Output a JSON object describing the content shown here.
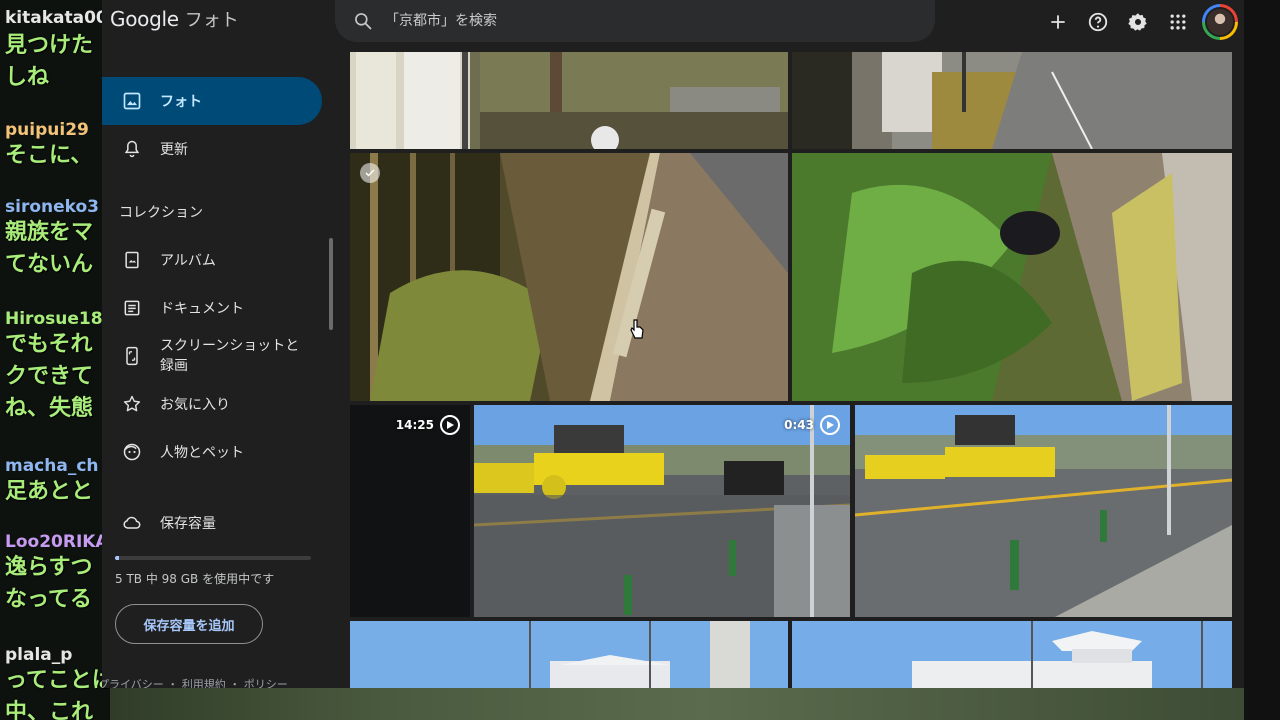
{
  "chat": {
    "messages": [
      {
        "user": "kitakata00",
        "lines": [
          "見つけた",
          "しね"
        ]
      },
      {
        "user": "puipui29",
        "lines": [
          "そこに、"
        ]
      },
      {
        "user": "sironeko3",
        "lines": [
          "親族をマ",
          "てないん"
        ]
      },
      {
        "user": "Hirosue18",
        "lines": [
          "でもそれ",
          "クできて",
          "ね、失態"
        ]
      },
      {
        "user": "macha_ch",
        "lines": [
          "足あとと"
        ]
      },
      {
        "user": "Loo20RIKA",
        "lines": [
          "逸らすつ",
          "なってる"
        ]
      },
      {
        "user": "plala_p",
        "lines": [
          "ってことは、",
          "中、これ"
        ]
      }
    ],
    "user_colors": {
      "kitakata00": "#e6e6e6",
      "puipui29": "#f4c37a",
      "sironeko3": "#8fb6f0",
      "Hirosue18": "#a8ec7a",
      "macha_ch": "#8fb6f0",
      "Loo20RIKA": "#c79bf2",
      "plala_p": "#e6e6e6"
    }
  },
  "app": {
    "logo_google": "Google",
    "logo_photos": "フォト",
    "search_placeholder": "「京都市」を検索",
    "top_icons": [
      "plus-icon",
      "help-icon",
      "settings-icon",
      "apps-grid-icon"
    ],
    "accent": "#004a77"
  },
  "sidebar": {
    "items": [
      {
        "label": "フォト",
        "icon": "photo-icon",
        "active": true
      },
      {
        "label": "更新",
        "icon": "bell-icon",
        "active": false
      }
    ],
    "collections_heading": "コレクション",
    "collections": [
      {
        "label": "アルバム",
        "icon": "album-icon"
      },
      {
        "label": "ドキュメント",
        "icon": "document-icon"
      },
      {
        "label": "スクリーンショットと録画",
        "icon": "phone-icon"
      },
      {
        "label": "お気に入り",
        "icon": "star-icon"
      },
      {
        "label": "人物とペット",
        "icon": "face-icon"
      }
    ],
    "storage_label": "保存容量",
    "storage_text": "5 TB 中 98 GB を使用中です",
    "storage_used_fraction": 0.02,
    "add_storage": "保存容量を追加",
    "footer": "プライバシー ・ 利用規約 ・ ポリシー"
  },
  "grid": {
    "videos": [
      {
        "duration": "14:25"
      },
      {
        "duration": "0:43"
      }
    ]
  }
}
